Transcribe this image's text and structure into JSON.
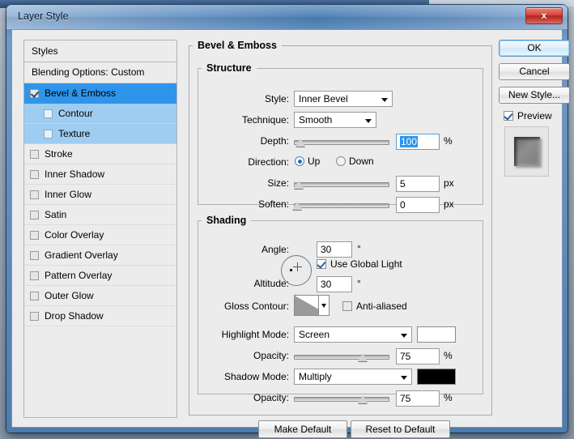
{
  "window": {
    "title": "Layer Style",
    "close_label": "x"
  },
  "styles_panel": {
    "header": "Styles",
    "blending_options": "Blending Options: Custom",
    "items": [
      {
        "label": "Bevel & Emboss",
        "checked": true,
        "selected": true,
        "sub": false
      },
      {
        "label": "Contour",
        "checked": false,
        "selected": false,
        "sub": true
      },
      {
        "label": "Texture",
        "checked": false,
        "selected": false,
        "sub": true
      },
      {
        "label": "Stroke",
        "checked": false,
        "selected": false,
        "sub": false
      },
      {
        "label": "Inner Shadow",
        "checked": false,
        "selected": false,
        "sub": false
      },
      {
        "label": "Inner Glow",
        "checked": false,
        "selected": false,
        "sub": false
      },
      {
        "label": "Satin",
        "checked": false,
        "selected": false,
        "sub": false
      },
      {
        "label": "Color Overlay",
        "checked": false,
        "selected": false,
        "sub": false
      },
      {
        "label": "Gradient Overlay",
        "checked": false,
        "selected": false,
        "sub": false
      },
      {
        "label": "Pattern Overlay",
        "checked": false,
        "selected": false,
        "sub": false
      },
      {
        "label": "Outer Glow",
        "checked": false,
        "selected": false,
        "sub": false
      },
      {
        "label": "Drop Shadow",
        "checked": false,
        "selected": false,
        "sub": false
      }
    ]
  },
  "main": {
    "group_title": "Bevel & Emboss",
    "structure": {
      "title": "Structure",
      "style_label": "Style:",
      "style_value": "Inner Bevel",
      "technique_label": "Technique:",
      "technique_value": "Smooth",
      "depth_label": "Depth:",
      "depth_value": "100",
      "depth_unit": "%",
      "direction_label": "Direction:",
      "direction_up": "Up",
      "direction_down": "Down",
      "direction_selected": "Up",
      "size_label": "Size:",
      "size_value": "5",
      "size_unit": "px",
      "soften_label": "Soften:",
      "soften_value": "0",
      "soften_unit": "px"
    },
    "shading": {
      "title": "Shading",
      "angle_label": "Angle:",
      "angle_value": "30",
      "angle_unit": "°",
      "use_global_light": "Use Global Light",
      "use_global_light_checked": true,
      "altitude_label": "Altitude:",
      "altitude_value": "30",
      "altitude_unit": "°",
      "gloss_contour_label": "Gloss Contour:",
      "anti_aliased": "Anti-aliased",
      "anti_aliased_checked": false,
      "highlight_mode_label": "Highlight Mode:",
      "highlight_mode_value": "Screen",
      "highlight_color": "#ffffff",
      "highlight_opacity_label": "Opacity:",
      "highlight_opacity_value": "75",
      "highlight_opacity_unit": "%",
      "shadow_mode_label": "Shadow Mode:",
      "shadow_mode_value": "Multiply",
      "shadow_color": "#000000",
      "shadow_opacity_label": "Opacity:",
      "shadow_opacity_value": "75",
      "shadow_opacity_unit": "%"
    },
    "make_default": "Make Default",
    "reset_to_default": "Reset to Default"
  },
  "right": {
    "ok": "OK",
    "cancel": "Cancel",
    "new_style": "New Style...",
    "preview_label": "Preview",
    "preview_checked": true
  },
  "colors": {
    "selection_blue": "#2e95ea",
    "sub_selection_blue": "#9fcdf2",
    "titlebar_blue": "#4b7fb5",
    "close_red": "#d6433b"
  }
}
